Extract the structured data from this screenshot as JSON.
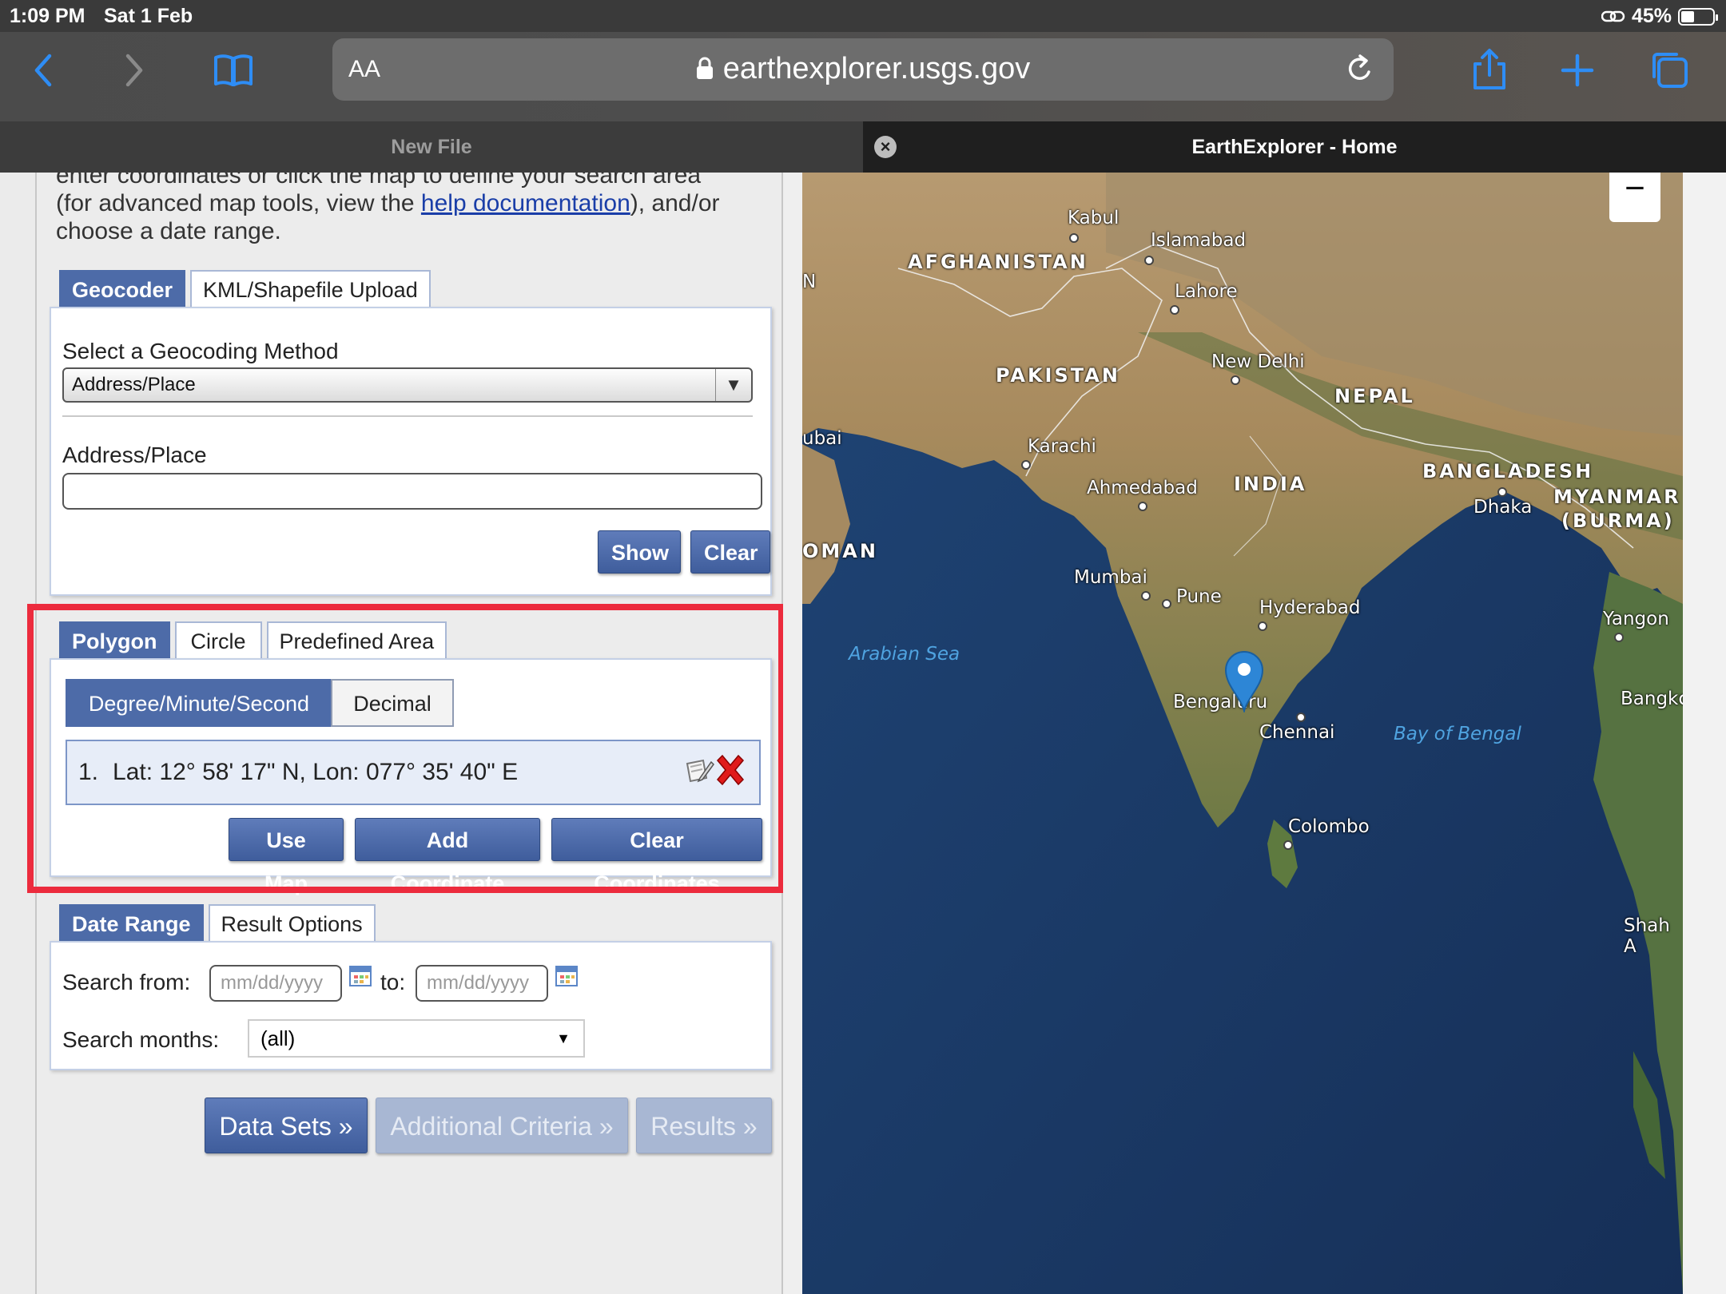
{
  "status_bar": {
    "time": "1:09 PM",
    "date": "Sat 1 Feb",
    "battery": "45%"
  },
  "browser": {
    "text_size_button": "AA",
    "url": "earthexplorer.usgs.gov",
    "tabs": [
      {
        "label": "New File",
        "active": false
      },
      {
        "label": "EarthExplorer - Home",
        "active": true
      }
    ]
  },
  "intro": {
    "line1": "enter coordinates or click the map to define your search area",
    "line2_prefix": "(for advanced map tools, view the ",
    "help_link": "help documentation",
    "line2_suffix": "), and/or",
    "line3": "choose a date range."
  },
  "geocoder": {
    "tabs": [
      "Geocoder",
      "KML/Shapefile Upload"
    ],
    "method_label": "Select a Geocoding Method",
    "method_value": "Address/Place",
    "address_label": "Address/Place",
    "address_value": "",
    "show_button": "Show",
    "clear_button": "Clear"
  },
  "area": {
    "tabs": [
      "Polygon",
      "Circle",
      "Predefined Area"
    ],
    "format_buttons": [
      "Degree/Minute/Second",
      "Decimal"
    ],
    "coordinates": [
      {
        "index": "1.",
        "text": "Lat: 12° 58' 17\" N, Lon: 077° 35' 40\" E"
      }
    ],
    "use_map_button": "Use Map",
    "add_coordinate_button": "Add Coordinate",
    "clear_coordinates_button": "Clear Coordinates"
  },
  "date_range": {
    "tabs": [
      "Date Range",
      "Result Options"
    ],
    "search_from_label": "Search from:",
    "from_placeholder": "mm/dd/yyyy",
    "to_label": "to:",
    "to_placeholder": "mm/dd/yyyy",
    "months_label": "Search months:",
    "months_value": "(all)"
  },
  "nav_buttons": {
    "data_sets": "Data Sets »",
    "additional_criteria": "Additional Criteria »",
    "results": "Results »"
  },
  "map": {
    "zoom_out": "−",
    "labels": {
      "kabul": "Kabul",
      "islamabad": "Islamabad",
      "afghanistan": "AFGHANISTAN",
      "lahore": "Lahore",
      "pakistan": "PAKISTAN",
      "new_delhi": "New Delhi",
      "nepal": "NEPAL",
      "dubai_partial": "ubai",
      "karachi": "Karachi",
      "ahmedabad": "Ahmedabad",
      "india": "INDIA",
      "bangladesh": "BANGLADESH",
      "dhaka": "Dhaka",
      "myanmar": "MYANMAR",
      "burma": "(BURMA)",
      "oman_partial": "OMAN",
      "mumbai": "Mumbai",
      "pune": "Pune",
      "hyderabad": "Hyderabad",
      "yangon": "Yangon",
      "arabian_sea": "Arabian Sea",
      "bengaluru": "Bengaluru",
      "chennai": "Chennai",
      "bay_of_bengal": "Bay of Bengal",
      "bangkok_partial": "Bangkc",
      "colombo": "Colombo",
      "shah_partial": "Shah A",
      "edge_n": "N"
    }
  },
  "colors": {
    "accent": "#4d6ba8",
    "highlight": "#ec2b3d",
    "ocean": "#1c3a66",
    "pin": "#2d86d6"
  }
}
